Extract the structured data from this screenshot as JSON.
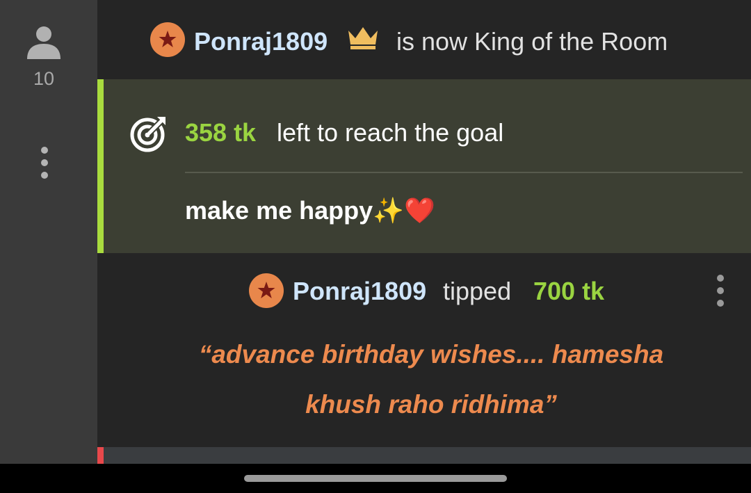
{
  "rail": {
    "viewer_count": "10",
    "viewer_icon": "user-silhouette-icon",
    "more_icon": "vertical-ellipsis-icon"
  },
  "king_event": {
    "badge_icon": "star-badge-icon",
    "username": "Ponraj1809",
    "crown_icon": "crown-icon",
    "message": "is now King of the Room"
  },
  "goal": {
    "icon": "target-icon",
    "amount": "358 tk",
    "message": "left to reach the goal",
    "description": "make me happy✨❤️"
  },
  "tip": {
    "badge_icon": "star-badge-icon",
    "username": "Ponraj1809",
    "verb": "tipped",
    "amount": "700 tk",
    "message_line1": "“advance birthday wishes.... hamesha",
    "message_line2": "khush raho ridhima”",
    "more_icon": "vertical-ellipsis-icon"
  },
  "colors": {
    "username": "#cfe5fb",
    "token_amount": "#9ad441",
    "tip_message": "#ed8a4e",
    "badge": "#e8874b",
    "goal_accent": "#a9dc3e",
    "next_accent": "#e8484b"
  }
}
